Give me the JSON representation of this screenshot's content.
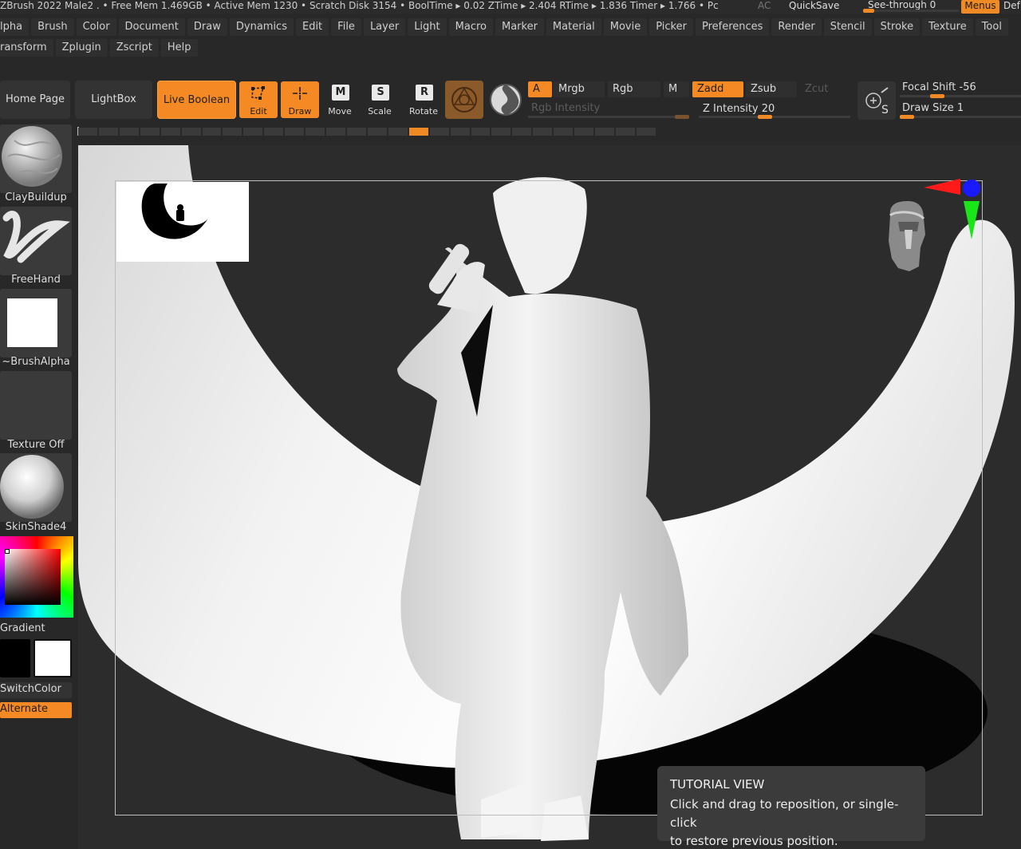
{
  "titlebar": {
    "status": "ZBrush 2022    Male2   . • Free Mem 1.469GB • Active Mem 1230 • Scratch Disk 3154 •  BoolTime ▸ 0.02 ZTime ▸ 2.404 RTime ▸ 1.836 Timer ▸ 1.766 • Pc",
    "ac": "AC",
    "quicksave": "QuickSave",
    "see_through": "See-through   0",
    "menus": "Menus",
    "default_script": "Def"
  },
  "menu_row1": [
    "lpha",
    "Brush",
    "Color",
    "Document",
    "Draw",
    "Dynamics",
    "Edit",
    "File",
    "Layer",
    "Light",
    "Macro",
    "Marker",
    "Material",
    "Movie",
    "Picker",
    "Preferences",
    "Render",
    "Stencil",
    "Stroke",
    "Texture",
    "Tool"
  ],
  "menu_row2": [
    "ransform",
    "Zplugin",
    "Zscript",
    "Help"
  ],
  "shelf": {
    "home_page": "Home Page",
    "lightbox": "LightBox",
    "live_boolean": "Live Boolean",
    "edit": "Edit",
    "draw": "Draw",
    "move": "Move",
    "scale": "Scale",
    "rotate": "Rotate",
    "move_key": "M",
    "scale_key": "S",
    "rotate_key": "R"
  },
  "options": {
    "a": "A",
    "mrgb": "Mrgb",
    "rgb": "Rgb",
    "m": "M",
    "zadd": "Zadd",
    "zsub": "Zsub",
    "zcut": "Zcut",
    "rgb_intensity": "Rgb Intensity",
    "z_intensity": "Z Intensity 20",
    "focal_shift": "Focal Shift  -56",
    "draw_size": "Draw Size  1",
    "z_intensity_value": 20,
    "focal_shift_value": -56,
    "draw_size_value": 1
  },
  "left_tray": {
    "brush": "ClayBuildup",
    "stroke": "FreeHand",
    "alpha": "~BrushAlpha",
    "texture": "Texture Off",
    "material": "SkinShade4",
    "gradient": "Gradient",
    "switch_color": "SwitchColor",
    "alternate": "Alternate"
  },
  "tooltip": {
    "title": "TUTORIAL VIEW",
    "body_line1": "Click and drag to reposition, or single-click",
    "body_line2": "to restore previous position."
  },
  "colors": {
    "accent": "#f58a25",
    "background": "#282828",
    "axis_x": "#ff1a1a",
    "axis_y": "#19e619",
    "axis_z": "#1a1aff"
  },
  "icons": [
    "edit-icon",
    "draw-icon",
    "move-icon",
    "scale-icon",
    "rotate-icon",
    "material-sphere-icon",
    "s-curve-icon",
    "lazy-mouse-icon",
    "orientation-head-icon"
  ]
}
